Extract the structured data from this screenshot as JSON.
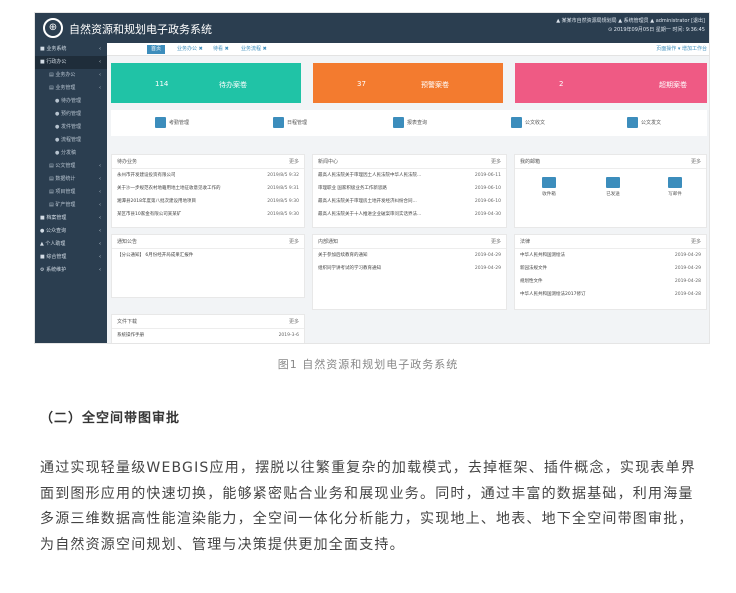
{
  "app": {
    "title": "自然资源和规划电子政务系统",
    "logo": "⊕",
    "top_right_line1": "▲ 某某市自然资源局规划局  ▲ 系统管理员  ▲ administrator  [退出]",
    "top_right_line2": "⊙ 2019年09月05日 星期一 时间: 9:36:45"
  },
  "sidebar": [
    {
      "label": "■ 业务系统",
      "level": 0,
      "active": false
    },
    {
      "label": "■ 行政办公",
      "level": 0,
      "active": true
    },
    {
      "label": "▤ 业务办公",
      "level": 1,
      "active": false
    },
    {
      "label": "▤ 业务管理",
      "level": 1,
      "active": false
    },
    {
      "label": "● 待办管理",
      "level": 2,
      "active": false
    },
    {
      "label": "● 预约管理",
      "level": 2,
      "active": false
    },
    {
      "label": "● 发件管理",
      "level": 2,
      "active": false
    },
    {
      "label": "● 流程管理",
      "level": 2,
      "active": false
    },
    {
      "label": "● 分发稿",
      "level": 2,
      "active": false
    },
    {
      "label": "▤ 公文管理",
      "level": 1,
      "active": false
    },
    {
      "label": "▤ 数据统计",
      "level": 1,
      "active": false
    },
    {
      "label": "▤ 项目管理",
      "level": 1,
      "active": false
    },
    {
      "label": "▤ 矿产管理",
      "level": 1,
      "active": false
    },
    {
      "label": "■ 档案管理",
      "level": 0,
      "active": false
    },
    {
      "label": "● 公众查询",
      "level": 0,
      "active": false
    },
    {
      "label": "▲ 个人助理",
      "level": 0,
      "active": false
    },
    {
      "label": "■ 综合管理",
      "level": 0,
      "active": false
    },
    {
      "label": "⚙ 系统维护",
      "level": 0,
      "active": false
    }
  ],
  "tabs": [
    {
      "label": "首页",
      "active": true
    },
    {
      "label": "业务办公 ✖",
      "active": false
    },
    {
      "label": "待看 ✖",
      "active": false
    },
    {
      "label": "业务流程 ✖",
      "active": false
    }
  ],
  "tab_right": "页面操作 ▾  增加工作台",
  "stats": [
    {
      "value": "114",
      "label": "待办案卷",
      "color": "#20c3a6"
    },
    {
      "value": "37",
      "label": "预警案卷",
      "color": "#f37b2f"
    },
    {
      "value": "2",
      "label": "超期案卷",
      "color": "#ef5a84"
    }
  ],
  "quick_links": [
    "考勤管理",
    "日程管理",
    "报表查询",
    "公文收文",
    "公文发文"
  ],
  "panels": {
    "todo": {
      "title": "待办业务",
      "more": "更多",
      "rows": [
        {
          "text": "永州市开发建设投资有限公司",
          "date": "2019/8/5 9:32"
        },
        {
          "text": "关于沙一步规范农村地籍用地土地征收意见收工作的",
          "date": "2019/8/5 9:31"
        },
        {
          "text": "湘潭县2018年度第八批次建设用地项目",
          "date": "2019/8/5 9:30"
        },
        {
          "text": "某区市县10家金有限公司某某矿",
          "date": "2019/8/5 9:30"
        }
      ]
    },
    "news": {
      "title": "新闻中心",
      "more": "更多",
      "rows": [
        {
          "text": "最高人民法院关于审理因土人民法院中华人民法院...",
          "date": "2019-06-11"
        },
        {
          "text": "审理职业 国家积极业务工作新思路",
          "date": "2019-06-10"
        },
        {
          "text": "最高人民法院关于审理房土地开发经济纠纷合同... ",
          "date": "2019-06-10"
        },
        {
          "text": "最高人民法院关于十人推进企业破案审问实话界法...",
          "date": "2019-04-30"
        }
      ]
    },
    "mail": {
      "title": "我的邮箱",
      "more": "更多",
      "items": [
        "收件箱",
        "已发送",
        "写邮件"
      ]
    },
    "notice": {
      "title": "通知公告",
      "more": "更多",
      "rows": [
        {
          "text": "【分公通知】 6月份经开局成果汇报件",
          "date": ""
        }
      ]
    },
    "internal": {
      "title": "内部通知",
      "more": "更多",
      "rows": [
        {
          "text": "关于参加后续教育的通知",
          "date": "2019-04-29"
        },
        {
          "text": "组织同学讲考试的学习教育通知",
          "date": "2019-04-29"
        }
      ]
    },
    "law": {
      "title": "法律",
      "more": "更多",
      "rows": [
        {
          "text": "中华人民共和国测绘法",
          "date": "2019-04-29"
        },
        {
          "text": "新园法规文件",
          "date": "2019-04-29"
        },
        {
          "text": "规划性文件",
          "date": "2019-04-28"
        },
        {
          "text": "中华人民共和国测绘法2017修订",
          "date": "2019-04-28"
        }
      ]
    },
    "download": {
      "title": "文件下载",
      "more": "更多",
      "rows": [
        {
          "text": "系统操作手册",
          "date": "2019-3-6"
        }
      ]
    }
  },
  "caption": "图1 自然资源和规划电子政务系统",
  "heading": "（二）全空间带图审批",
  "paragraph": "通过实现轻量级WEBGIS应用，摆脱以往繁重复杂的加载模式，去掉框架、插件概念，实现表单界面到图形应用的快速切换，能够紧密贴合业务和展现业务。同时，通过丰富的数据基础，利用海量多源三维数据高性能渲染能力，全空间一体化分析能力，实现地上、地表、地下全空间带图审批，为自然资源空间规划、管理与决策提供更加全面支持。"
}
